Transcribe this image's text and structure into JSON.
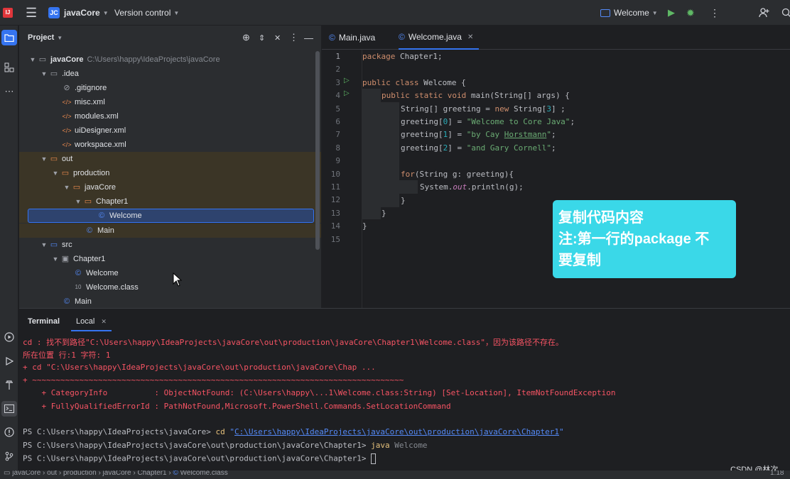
{
  "titlebar": {
    "project_badge": "JC",
    "project_name": "javaCore",
    "vcs_label": "Version control",
    "run_config": "Welcome"
  },
  "project_panel": {
    "title": "Project",
    "tree": [
      {
        "label": "javaCore",
        "extra": "C:\\Users\\happy\\IdeaProjects\\javaCore"
      },
      {
        "label": ".idea"
      },
      {
        "label": ".gitignore"
      },
      {
        "label": "misc.xml"
      },
      {
        "label": "modules.xml"
      },
      {
        "label": "uiDesigner.xml"
      },
      {
        "label": "workspace.xml"
      },
      {
        "label": "out"
      },
      {
        "label": "production"
      },
      {
        "label": "javaCore"
      },
      {
        "label": "Chapter1"
      },
      {
        "label": "Welcome"
      },
      {
        "label": "Main"
      },
      {
        "label": "src"
      },
      {
        "label": "Chapter1"
      },
      {
        "label": "Welcome"
      },
      {
        "label": "Welcome.class"
      },
      {
        "label": "Main"
      }
    ]
  },
  "editor": {
    "tabs": [
      {
        "label": "Main.java"
      },
      {
        "label": "Welcome.java"
      }
    ],
    "line_numbers": [
      "1",
      "2",
      "3",
      "4",
      "5",
      "6",
      "7",
      "8",
      "9",
      "10",
      "11",
      "12",
      "13",
      "14",
      "15"
    ],
    "code": {
      "l1a": "package",
      "l1b": " Chapter1;",
      "l3a": "public class",
      "l3b": " Welcome {",
      "l4a": "public static void",
      "l4b": " main(String[] ",
      "l4c": "args",
      "l4d": ") {",
      "l5a": "String[] greeting = ",
      "l5b": "new",
      "l5c": " String[",
      "l5d": "3",
      "l5e": "] ;",
      "l6a": "greeting[",
      "l6b": "0",
      "l6c": "] = ",
      "l6d": "\"Welcome to Core Java\"",
      "l6e": ";",
      "l7a": "greeting[",
      "l7b": "1",
      "l7c": "] = ",
      "l7d": "\"by Cay ",
      "l7e": "Horstmann",
      "l7f": "\"",
      "l7g": ";",
      "l8a": "greeting[",
      "l8b": "2",
      "l8c": "] = ",
      "l8d": "\"and Gary Cornell\"",
      "l8e": ";",
      "l10a": "for",
      "l10b": "(String g: greeting){",
      "l11a": "System.",
      "l11b": "out",
      "l11c": ".println(g);",
      "l12": "}",
      "l13": "}",
      "l14": "}"
    }
  },
  "annotation": {
    "line1": "复制代码内容",
    "line2": "注:第一行的package 不",
    "line3": "要复制"
  },
  "terminal": {
    "tab_title": "Terminal",
    "tab_local": "Local",
    "lines": {
      "e1": "cd : 找不到路径\"C:\\Users\\happy\\IdeaProjects\\javaCore\\out\\production\\javaCore\\Chapter1\\Welcome.class\"，因为该路径不存在。",
      "e2": "所在位置 行:1 字符: 1",
      "e3": "+ cd \"C:\\Users\\happy\\IdeaProjects\\javaCore\\out\\production\\javaCore\\Chap ...",
      "e4": "+ ~~~~~~~~~~~~~~~~~~~~~~~~~~~~~~~~~~~~~~~~~~~~~~~~~~~~~~~~~~~~~~~~~~~~~~~~~~~~~~~",
      "e5": "    + CategoryInfo          : ObjectNotFound: (C:\\Users\\happy\\...1\\Welcome.class:String) [Set-Location], ItemNotFoundException",
      "e6": "    + FullyQualifiedErrorId : PathNotFound,Microsoft.PowerShell.Commands.SetLocationCommand",
      "p1a": "PS C:\\Users\\happy\\IdeaProjects\\javaCore> ",
      "p1b": "cd",
      "p1c": " \"",
      "p1d": "C:\\Users\\happy\\IdeaProjects\\javaCore\\out\\production\\javaCore\\Chapter1",
      "p1e": "\"",
      "p2a": "PS C:\\Users\\happy\\IdeaProjects\\javaCore\\out\\production\\javaCore\\Chapter1> ",
      "p2b": "java",
      "p2c": " Welcome",
      "p3a": "PS C:\\Users\\happy\\IdeaProjects\\javaCore\\out\\production\\javaCore\\Chapter1> "
    }
  },
  "statusbar": {
    "crumbs": [
      "javaCore",
      "out",
      "production",
      "javaCore",
      "Chapter1",
      "Welcome.class"
    ],
    "watermark": "CSDN @林次",
    "position": "1:18"
  },
  "colors": {
    "accent": "#3574f0",
    "note_bg": "#3ad8e8",
    "error_text": "#f75464"
  }
}
